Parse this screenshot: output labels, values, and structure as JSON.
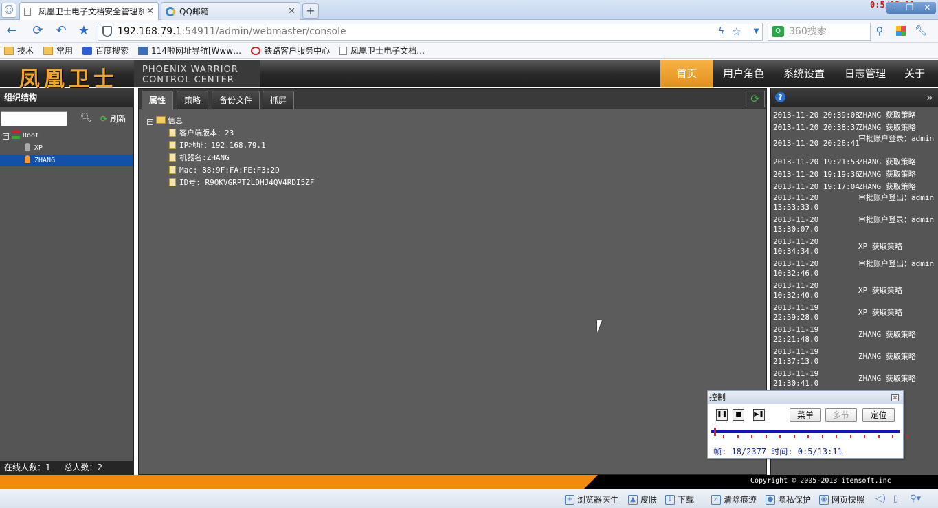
{
  "browser": {
    "tabs": [
      {
        "title": "凤凰卫士电子文档安全管理系统",
        "close": "✕"
      },
      {
        "title": "QQ邮箱",
        "close": "✕"
      }
    ],
    "new_tab": "+",
    "url_host": "192.168.79.1",
    "url_path": ":54911/admin/webmaster/console",
    "search_placeholder": "360搜索",
    "bookmarks": [
      "技术",
      "常用",
      "百度搜索",
      "114啦网址导航[Www…",
      "铁路客户服务中心",
      "凤凰卫士电子文档…"
    ],
    "recording_time": "0:5/13:11"
  },
  "app": {
    "logo_cn": "凤凰卫士",
    "logo_en_line1": "PHOENIX WARRIOR",
    "logo_en_line2": "CONTROL CENTER",
    "nav": [
      "首页",
      "用户角色",
      "系统设置",
      "日志管理",
      "关于"
    ]
  },
  "left": {
    "title": "组织结构",
    "refresh": "刷新",
    "tree": [
      "Root",
      "XP",
      "ZHANG"
    ],
    "status_online_label": "在线人数：",
    "status_online": "1",
    "status_total_label": "总人数：",
    "status_total": "2"
  },
  "center": {
    "tabs": [
      "属性",
      "策略",
      "备份文件",
      "抓屏"
    ],
    "root": "信息",
    "items": [
      "客户端版本：23",
      "IP地址：192.168.79.1",
      "机器名:ZHANG",
      "Mac: 88:9F:FA:FE:F3:2D",
      "ID号: R9OKVGRPT2LDHJ4QV4RDI5ZF"
    ]
  },
  "right": {
    "logs": [
      {
        "t": "2013-11-20 20:39:08",
        "m": "ZHANG 获取策略"
      },
      {
        "t": "2013-11-20 20:38:37",
        "m": "ZHANG 获取策略"
      },
      {
        "t": "2013-11-20 20:26:41",
        "m": "审批账户登录：admin"
      },
      {
        "t": "2013-11-20 19:21:53",
        "m": "ZHANG 获取策略"
      },
      {
        "t": "2013-11-20 19:19:36",
        "m": "ZHANG 获取策略"
      },
      {
        "t": "2013-11-20 19:17:04",
        "m": "ZHANG 获取策略"
      },
      {
        "t": "2013-11-20 13:53:33.0",
        "m": "审批账户登出：admin"
      },
      {
        "t": "2013-11-20 13:30:07.0",
        "m": "审批账户登录：admin"
      },
      {
        "t": "2013-11-20 10:34:34.0",
        "m": "XP 获取策略"
      },
      {
        "t": "2013-11-20 10:32:46.0",
        "m": "审批账户登出：admin"
      },
      {
        "t": "2013-11-20 10:32:40.0",
        "m": "XP 获取策略"
      },
      {
        "t": "2013-11-19 22:59:28.0",
        "m": "XP 获取策略"
      },
      {
        "t": "2013-11-19 22:21:48.0",
        "m": "ZHANG 获取策略"
      },
      {
        "t": "2013-11-19 21:37:13.0",
        "m": "ZHANG 获取策略"
      },
      {
        "t": "2013-11-19 21:30:41.0",
        "m": "ZHANG 获取策略"
      }
    ]
  },
  "control": {
    "title": "控制",
    "menu": "菜单",
    "multi": "多节",
    "locate": "定位",
    "frame_label": "帧:",
    "frame": "18/2377",
    "time_label": "时间:",
    "time": "0:5/13:11",
    "progress": 0.02
  },
  "footer": {
    "copyright": "Copyright © 2005-2013 itensoft.inc"
  },
  "statusbar": [
    "浏览器医生",
    "皮肤",
    "下载",
    "清除痕迹",
    "隐私保护",
    "网页快照"
  ]
}
